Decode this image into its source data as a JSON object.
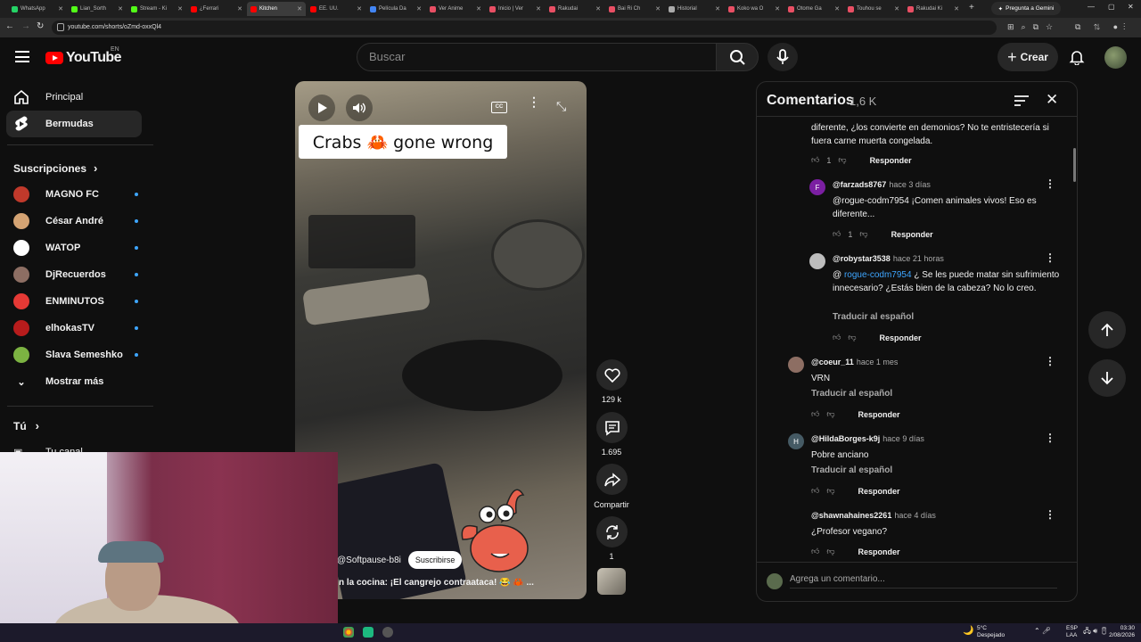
{
  "browser": {
    "tabs": [
      {
        "title": "WhatsApp",
        "color": "#25d366"
      },
      {
        "title": "Lian_Sorth",
        "color": "#53fc18"
      },
      {
        "title": "Stream - Ki",
        "color": "#53fc18"
      },
      {
        "title": "¿Ferrari",
        "color": "#ff0000"
      },
      {
        "title": "Kitchen",
        "color": "#ff0000",
        "active": true
      },
      {
        "title": "EE. UU.",
        "color": "#ff0000"
      },
      {
        "title": "Película Da",
        "color": "#4285f4"
      },
      {
        "title": "Ver Anime",
        "color": "#e94f64"
      },
      {
        "title": "Inicio | Ver",
        "color": "#e94f64"
      },
      {
        "title": "Rakudai",
        "color": "#e94f64"
      },
      {
        "title": "Bai Ri Ch",
        "color": "#e94f64"
      },
      {
        "title": "Historial",
        "color": "#aaaaaa"
      },
      {
        "title": "Koko wa O",
        "color": "#e94f64"
      },
      {
        "title": "Otome Ga",
        "color": "#e94f64"
      },
      {
        "title": "Touhou se",
        "color": "#e94f64"
      },
      {
        "title": "Rakudai Ki",
        "color": "#e94f64"
      }
    ],
    "new_tab": "+",
    "gemini_label": "Pregunta a Gemini",
    "url": "youtube.com/shorts/oZmd-oxxQl4"
  },
  "header": {
    "logo_text": "YouTube",
    "region": "EN",
    "search_placeholder": "Buscar",
    "create_label": "Crear"
  },
  "sidebar": {
    "main": [
      {
        "label": "Principal",
        "icon": "home-icon"
      },
      {
        "label": "Bermudas",
        "icon": "shorts-icon",
        "active": true
      }
    ],
    "subscriptions_title": "Suscripciones",
    "subscriptions": [
      {
        "name": "MAGNO FC",
        "color": "#c0392b"
      },
      {
        "name": "César André",
        "color": "#d4a373"
      },
      {
        "name": "WATOP",
        "color": "#ffffff"
      },
      {
        "name": "DjRecuerdos",
        "color": "#8d6e63"
      },
      {
        "name": "ENMINUTOS",
        "color": "#e53935"
      },
      {
        "name": "elhokasTV",
        "color": "#b71c1c"
      },
      {
        "name": "Slava Semeshko",
        "color": "#7cb342"
      }
    ],
    "show_more": "Mostrar más",
    "you_title": "Tú",
    "your_channel": "Tu canal"
  },
  "video": {
    "title_overlay": "Crabs 🦀 gone wrong",
    "channel": "@Softpause-b8i",
    "subscribe_label": "Suscribirse",
    "description": "n la cocina: ¡El cangrejo contraataca! 😂 🦀 ...",
    "likes": "129 k",
    "comments": "1.695",
    "share_label": "Compartir",
    "remix_count": "1"
  },
  "comments": {
    "title": "Comentarios",
    "count": "1,6 K",
    "items": [
      {
        "text": "diferente, ¿los convierte en demonios? No te entristecería si fuera carne muerta congelada.",
        "likes": "1"
      },
      {
        "handle": "@farzads8767",
        "time": "hace 3 días",
        "avatar": "F",
        "avatar_color": "#7b1fa2",
        "text": "@rogue-codm7954 ¡Comen animales vivos! Eso es diferente...",
        "likes": "1"
      },
      {
        "handle": "@robystar3538",
        "time": "hace 21 horas",
        "mention": "rogue-codm7954",
        "text_before": "@ ",
        "text": " ¿  Se les puede matar sin sufrimiento innecesario? ¿Estás bien de la cabeza? No lo creo.",
        "translate": "Traducir al español"
      },
      {
        "handle": "@coeur_11",
        "time": "hace 1 mes",
        "text": "VRN",
        "translate": "Traducir al español"
      },
      {
        "handle": "@HildaBorges-k9j",
        "time": "hace 9 días",
        "avatar": "H",
        "avatar_color": "#455a64",
        "text": "Pobre anciano",
        "translate": "Traducir al español"
      },
      {
        "handle": "@shawnahaines2261",
        "time": "hace 4 días",
        "text": "¿Profesor vegano?"
      }
    ],
    "reply_label": "Responder",
    "add_placeholder": "Agrega un comentario..."
  },
  "taskbar": {
    "weather_temp": "5°C",
    "weather_desc": "Despejado",
    "lang": "ESP",
    "lang2": "LAA",
    "time": "03:30",
    "date": "2/08/2026"
  }
}
